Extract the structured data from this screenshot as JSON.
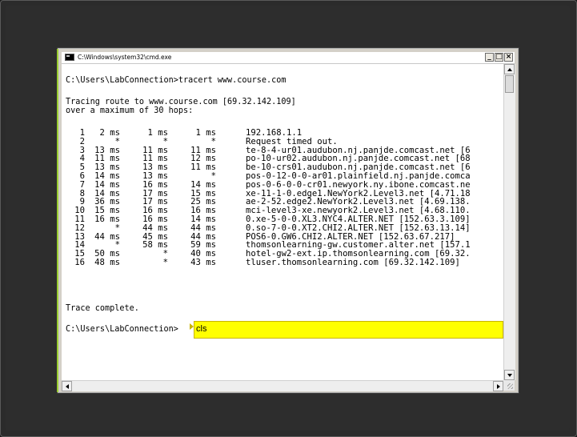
{
  "window": {
    "title": "C:\\Windows\\system32\\cmd.exe",
    "minimize_glyph": "_",
    "maximize_glyph": "□",
    "close_glyph": "×"
  },
  "console": {
    "command_line": "C:\\Users\\LabConnection>tracert www.course.com",
    "tracing_line1": "Tracing route to www.course.com [69.32.142.109]",
    "tracing_line2": "over a maximum of 30 hops:",
    "hops": [
      {
        "hop": "1",
        "t1": "2 ms",
        "t2": "1 ms",
        "t3": "1 ms",
        "host": "192.168.1.1"
      },
      {
        "hop": "2",
        "t1": "*",
        "t2": "*",
        "t3": "*",
        "host": "Request timed out."
      },
      {
        "hop": "3",
        "t1": "13 ms",
        "t2": "11 ms",
        "t3": "11 ms",
        "host": "te-8-4-ur01.audubon.nj.panjde.comcast.net [6"
      },
      {
        "hop": "4",
        "t1": "11 ms",
        "t2": "11 ms",
        "t3": "12 ms",
        "host": "po-10-ur02.audubon.nj.panjde.comcast.net [68"
      },
      {
        "hop": "5",
        "t1": "13 ms",
        "t2": "13 ms",
        "t3": "11 ms",
        "host": "be-10-crs01.audubon.nj.panjde.comcast.net [6"
      },
      {
        "hop": "6",
        "t1": "14 ms",
        "t2": "13 ms",
        "t3": "*",
        "host": "pos-0-12-0-0-ar01.plainfield.nj.panjde.comca"
      },
      {
        "hop": "7",
        "t1": "14 ms",
        "t2": "16 ms",
        "t3": "14 ms",
        "host": "pos-0-6-0-0-cr01.newyork.ny.ibone.comcast.ne"
      },
      {
        "hop": "8",
        "t1": "14 ms",
        "t2": "17 ms",
        "t3": "15 ms",
        "host": "xe-11-1-0.edge1.NewYork2.Level3.net [4.71.18"
      },
      {
        "hop": "9",
        "t1": "36 ms",
        "t2": "17 ms",
        "t3": "25 ms",
        "host": "ae-2-52.edge2.NewYork2.Level3.net [4.69.138."
      },
      {
        "hop": "10",
        "t1": "15 ms",
        "t2": "16 ms",
        "t3": "16 ms",
        "host": "mci-level3-xe.newyork2.Level3.net [4.68.110."
      },
      {
        "hop": "11",
        "t1": "16 ms",
        "t2": "16 ms",
        "t3": "14 ms",
        "host": "0.xe-5-0-0.XL3.NYC4.ALTER.NET [152.63.3.109]"
      },
      {
        "hop": "12",
        "t1": "*",
        "t2": "44 ms",
        "t3": "44 ms",
        "host": "0.so-7-0-0.XT2.CHI2.ALTER.NET [152.63.13.14]"
      },
      {
        "hop": "13",
        "t1": "44 ms",
        "t2": "45 ms",
        "t3": "44 ms",
        "host": "POS6-0.GW6.CHI2.ALTER.NET [152.63.67.217]"
      },
      {
        "hop": "14",
        "t1": "*",
        "t2": "58 ms",
        "t3": "59 ms",
        "host": "thomsonlearning-gw.customer.alter.net [157.1"
      },
      {
        "hop": "15",
        "t1": "50 ms",
        "t2": "*",
        "t3": "40 ms",
        "host": "hotel-gw2-ext.ip.thomsonlearning.com [69.32."
      },
      {
        "hop": "16",
        "t1": "48 ms",
        "t2": "*",
        "t3": "43 ms",
        "host": "tluser.thomsonlearning.com [69.32.142.109]"
      }
    ],
    "trace_complete": "Trace complete.",
    "prompt": "C:\\Users\\LabConnection>",
    "input_value": "cls"
  },
  "colors": {
    "highlight": "#ffff00",
    "highlight_border": "#c8b400",
    "console_bg": "#ffffff",
    "window_accent": "#9acd32"
  }
}
